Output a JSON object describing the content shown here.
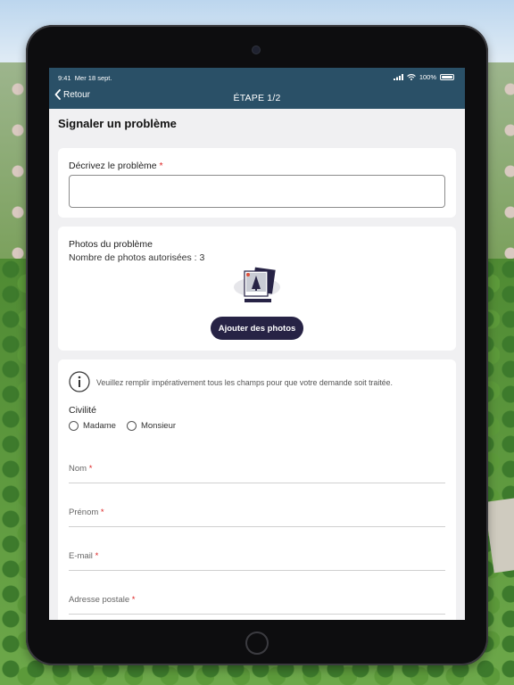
{
  "status_bar": {
    "time": "9:41",
    "date": "Mer 18 sept.",
    "battery": "100%",
    "icons": [
      "signal-icon",
      "wifi-icon",
      "battery-icon"
    ]
  },
  "nav": {
    "back_label": "Retour",
    "title": "ÉTAPE 1/2"
  },
  "page": {
    "title": "Signaler un problème"
  },
  "description": {
    "label": "Décrivez le problème",
    "required_mark": "*",
    "value": ""
  },
  "photos": {
    "title": "Photos du problème",
    "subtitle": "Nombre de photos autorisées : 3",
    "add_button": "Ajouter des photos"
  },
  "form": {
    "info_text": "Veuillez remplir impérativement tous les champs pour que votre demande soit traitée.",
    "civility_label": "Civilité",
    "civility_options": [
      "Madame",
      "Monsieur"
    ],
    "fields": [
      {
        "label": "Nom",
        "required_mark": "*"
      },
      {
        "label": "Prénom",
        "required_mark": "*"
      },
      {
        "label": "E-mail",
        "required_mark": "*"
      },
      {
        "label": "Adresse postale",
        "required_mark": "*"
      }
    ]
  },
  "colors": {
    "header": "#2a5067",
    "button": "#272345",
    "required": "#dd2222"
  }
}
